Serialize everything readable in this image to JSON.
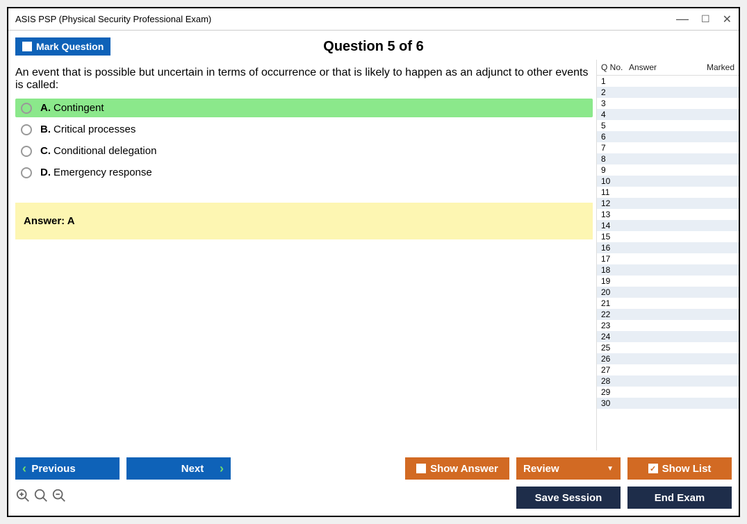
{
  "window_title": "ASIS PSP (Physical Security Professional Exam)",
  "mark_button": "Mark Question",
  "question_header": "Question 5 of 6",
  "question_text": "An event that is possible but uncertain in terms of occurrence or that is likely to happen as an adjunct to other events is called:",
  "options": [
    {
      "letter": "A.",
      "text": "Contingent",
      "selected": true
    },
    {
      "letter": "B.",
      "text": "Critical processes",
      "selected": false
    },
    {
      "letter": "C.",
      "text": "Conditional delegation",
      "selected": false
    },
    {
      "letter": "D.",
      "text": "Emergency response",
      "selected": false
    }
  ],
  "answer_label": "Answer: A",
  "list_headers": {
    "qno": "Q No.",
    "answer": "Answer",
    "marked": "Marked"
  },
  "list_count": 30,
  "buttons": {
    "previous": "Previous",
    "next": "Next",
    "show_answer": "Show Answer",
    "review": "Review",
    "show_list": "Show List",
    "save_session": "Save Session",
    "end_exam": "End Exam"
  }
}
